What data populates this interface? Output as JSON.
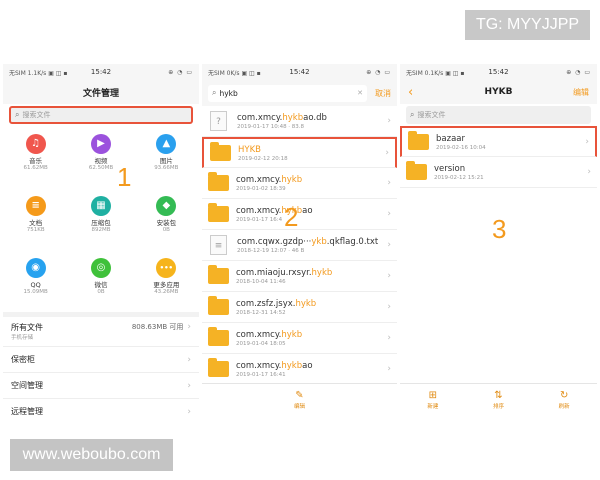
{
  "watermarks": {
    "tg": "TG: MYYJJPP",
    "web": "www.weboubo.com"
  },
  "status": {
    "p1_left": "无SIM 1.1K/s ▣ ◫ ▪",
    "p2_left": "无SIM 0K/s ▣ ◫ ▪",
    "p3_left": "无SIM 0.1K/s ▣ ◫ ▪",
    "time": "15:42",
    "right": "⊕ ◔ ▭"
  },
  "panel1": {
    "title": "文件管理",
    "search_placeholder": "搜索文件",
    "step": "1",
    "categories": [
      {
        "name": "音乐",
        "size": "61.62MB",
        "icon": "music-icon",
        "color": "#f0564d",
        "glyph": "♫"
      },
      {
        "name": "视频",
        "size": "62.50MB",
        "icon": "video-icon",
        "color": "#9b52dd",
        "glyph": "▶"
      },
      {
        "name": "图片",
        "size": "93.66MB",
        "icon": "picture-icon",
        "color": "#2aa0ee",
        "glyph": "▲"
      },
      {
        "name": "文档",
        "size": "751KB",
        "icon": "document-icon",
        "color": "#f59a1a",
        "glyph": "≡"
      },
      {
        "name": "压缩包",
        "size": "892MB",
        "icon": "archive-icon",
        "color": "#1fb0a2",
        "glyph": "▦"
      },
      {
        "name": "安装包",
        "size": "0B",
        "icon": "package-icon",
        "color": "#34bb54",
        "glyph": "◆"
      },
      {
        "name": "QQ",
        "size": "15.09MB",
        "icon": "qq-icon",
        "color": "#27a2ef",
        "glyph": "◉"
      },
      {
        "name": "微信",
        "size": "0B",
        "icon": "wechat-icon",
        "color": "#3fc13a",
        "glyph": "◎"
      },
      {
        "name": "更多应用",
        "size": "43.26MB",
        "icon": "more-apps-icon",
        "color": "#f6b41c",
        "glyph": "•••"
      }
    ],
    "all_files": {
      "label": "所有文件",
      "sub": "手机存储",
      "size": "808.63MB 可用"
    },
    "menu": [
      "保密柜",
      "空间管理",
      "远程管理"
    ]
  },
  "panel2": {
    "query": "hykb",
    "cancel": "取消",
    "step": "2",
    "edit_label": "编辑",
    "results": [
      {
        "type": "file",
        "pre": "com.xmcy.",
        "hit": "hykb",
        "post": "ao.db",
        "date": "2019-01-17 10:48 · 83.8"
      },
      {
        "type": "folder",
        "pre": "",
        "hit": "HYKB",
        "post": "",
        "date": "2019-02-12 20:18"
      },
      {
        "type": "folder",
        "pre": "com.xmcy.",
        "hit": "hykb",
        "post": "",
        "date": "2019-01-02 18:39"
      },
      {
        "type": "folder",
        "pre": "com.xmcy.",
        "hit": "hykb",
        "post": "ao",
        "date": "2019-01-17 16:4"
      },
      {
        "type": "text",
        "pre": "com.cqwx.gzdp···",
        "hit": "ykb",
        "post": ".qkflag.0.txt",
        "date": "2018-12-19 12:07 · 46 B"
      },
      {
        "type": "folder",
        "pre": "com.miaoju.rxsyr.",
        "hit": "hykb",
        "post": "",
        "date": "2018-10-04 11:46"
      },
      {
        "type": "folder",
        "pre": "com.zsfz.jsyx.",
        "hit": "hykb",
        "post": "",
        "date": "2018-12-31 14:52"
      },
      {
        "type": "folder",
        "pre": "com.xmcy.",
        "hit": "hykb",
        "post": "",
        "date": "2019-01-04 18:05"
      },
      {
        "type": "folder",
        "pre": "com.xmcy.",
        "hit": "hykb",
        "post": "ao",
        "date": "2019-01-17 16:41"
      }
    ]
  },
  "panel3": {
    "title": "HYKB",
    "edit": "编辑",
    "search_placeholder": "搜索文件",
    "step": "3",
    "folders": [
      {
        "name": "bazaar",
        "date": "2019-02-16 10:04"
      },
      {
        "name": "version",
        "date": "2019-02-12 15:21"
      }
    ],
    "bottom": [
      "新建",
      "排序",
      "刷新"
    ]
  }
}
